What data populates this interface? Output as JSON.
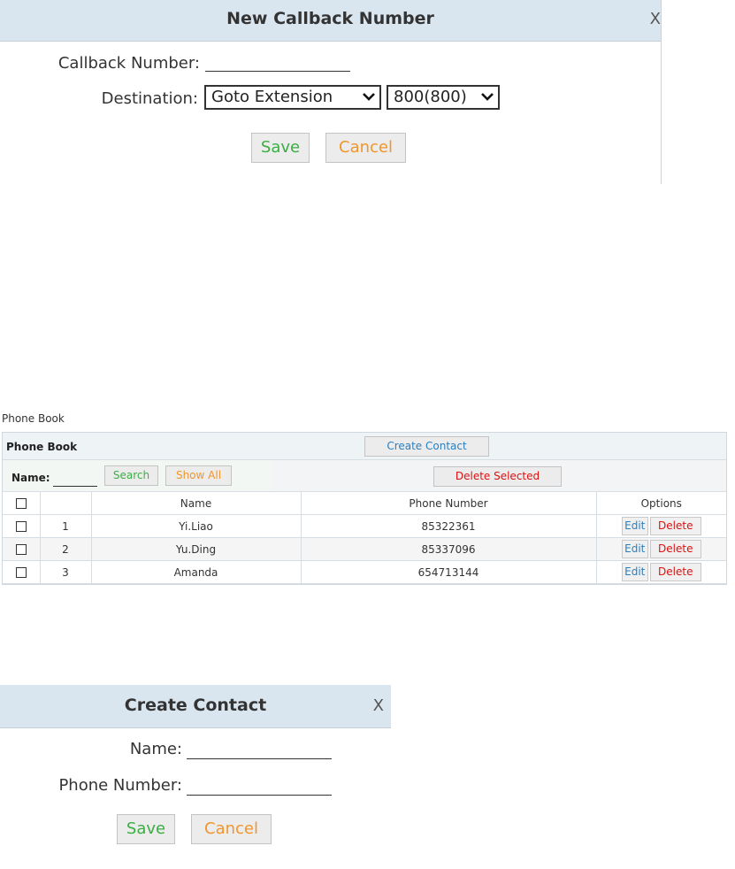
{
  "callback_dialog": {
    "title": "New Callback Number",
    "close": "X",
    "callback_number_label": "Callback Number:",
    "callback_number_value": "",
    "destination_label": "Destination:",
    "destination_type": "Goto Extension",
    "destination_target": "800(800)",
    "save_label": "Save",
    "cancel_label": "Cancel"
  },
  "phone_book": {
    "caption": "Phone Book",
    "title": "Phone Book",
    "create_contact_label": "Create Contact",
    "name_filter_label": "Name:",
    "name_filter_value": "",
    "search_label": "Search",
    "show_all_label": "Show All",
    "delete_selected_label": "Delete Selected",
    "columns": [
      "",
      "",
      "Name",
      "Phone Number",
      "Options"
    ],
    "rows": [
      {
        "index": "1",
        "name": "Yi.Liao",
        "phone": "85322361"
      },
      {
        "index": "2",
        "name": "Yu.Ding",
        "phone": "85337096"
      },
      {
        "index": "3",
        "name": "Amanda",
        "phone": "654713144"
      }
    ],
    "edit_label": "Edit",
    "delete_label": "Delete"
  },
  "contact_dialog": {
    "title": "Create Contact",
    "close": "X",
    "name_label": "Name:",
    "name_value": "",
    "phone_label": "Phone Number:",
    "phone_value": "",
    "save_label": "Save",
    "cancel_label": "Cancel"
  },
  "colors": {
    "header_bg": "#d9e5ef",
    "save_text": "#3bae43",
    "cancel_text": "#f0962d",
    "link_blue": "#2a7fc1",
    "danger_red": "#dd1111"
  },
  "icons": {
    "dropdown": "chevron-down-icon",
    "close": "close-icon",
    "checkbox": "checkbox-icon"
  }
}
